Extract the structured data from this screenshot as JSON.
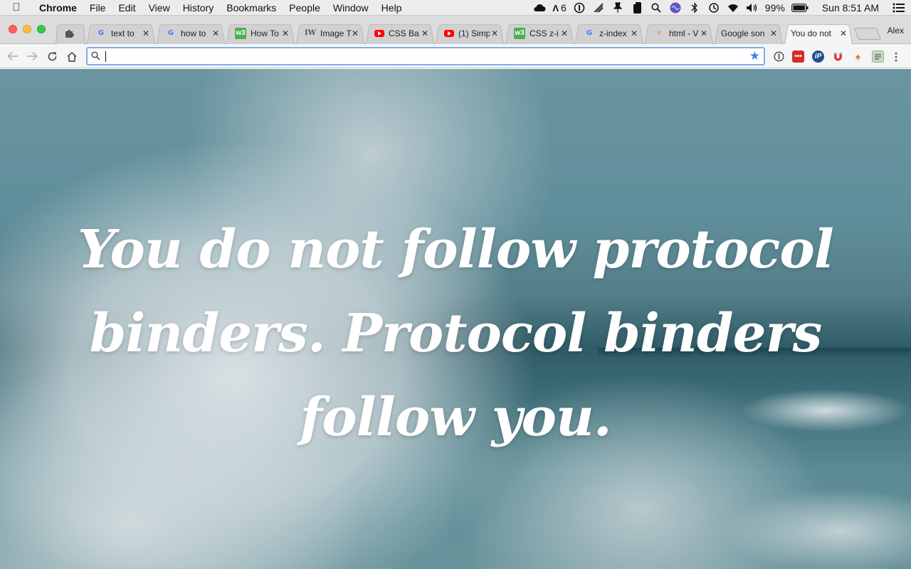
{
  "menubar": {
    "app_name": "Chrome",
    "items": [
      "File",
      "Edit",
      "View",
      "History",
      "Bookmarks",
      "People",
      "Window",
      "Help"
    ],
    "status": {
      "adobe_count": "6",
      "battery": "99%",
      "clock": "Sun 8:51 AM"
    }
  },
  "tabs": [
    {
      "title": "text to",
      "favicon": "google-icon"
    },
    {
      "title": "how to",
      "favicon": "google-icon"
    },
    {
      "title": "How To",
      "favicon": "w3schools-icon"
    },
    {
      "title": "Image T",
      "favicon": "iw-icon",
      "favicon_text": "IW"
    },
    {
      "title": "CSS Ba",
      "favicon": "youtube-icon"
    },
    {
      "title": "(1) Simp",
      "favicon": "youtube-icon"
    },
    {
      "title": "CSS z-i",
      "favicon": "w3schools-icon"
    },
    {
      "title": "z-index",
      "favicon": "google-icon"
    },
    {
      "title": "html - V",
      "favicon": "stackoverflow-icon"
    },
    {
      "title": "Google son",
      "favicon": "none"
    },
    {
      "title": "You do not",
      "favicon": "none",
      "active": true
    }
  ],
  "profile_name": "Alex",
  "omnibox": {
    "value": "",
    "bookmark_star_color": "#3b86f0"
  },
  "extensions": [
    "info-icon",
    "lastpass-icon",
    "ip-icon",
    "magnet-icon",
    "metamask-icon",
    "tab-manager-icon"
  ],
  "page": {
    "quote": "You do not follow protocol binders. Protocol binders follow you.",
    "background": "ocean wave photo"
  }
}
